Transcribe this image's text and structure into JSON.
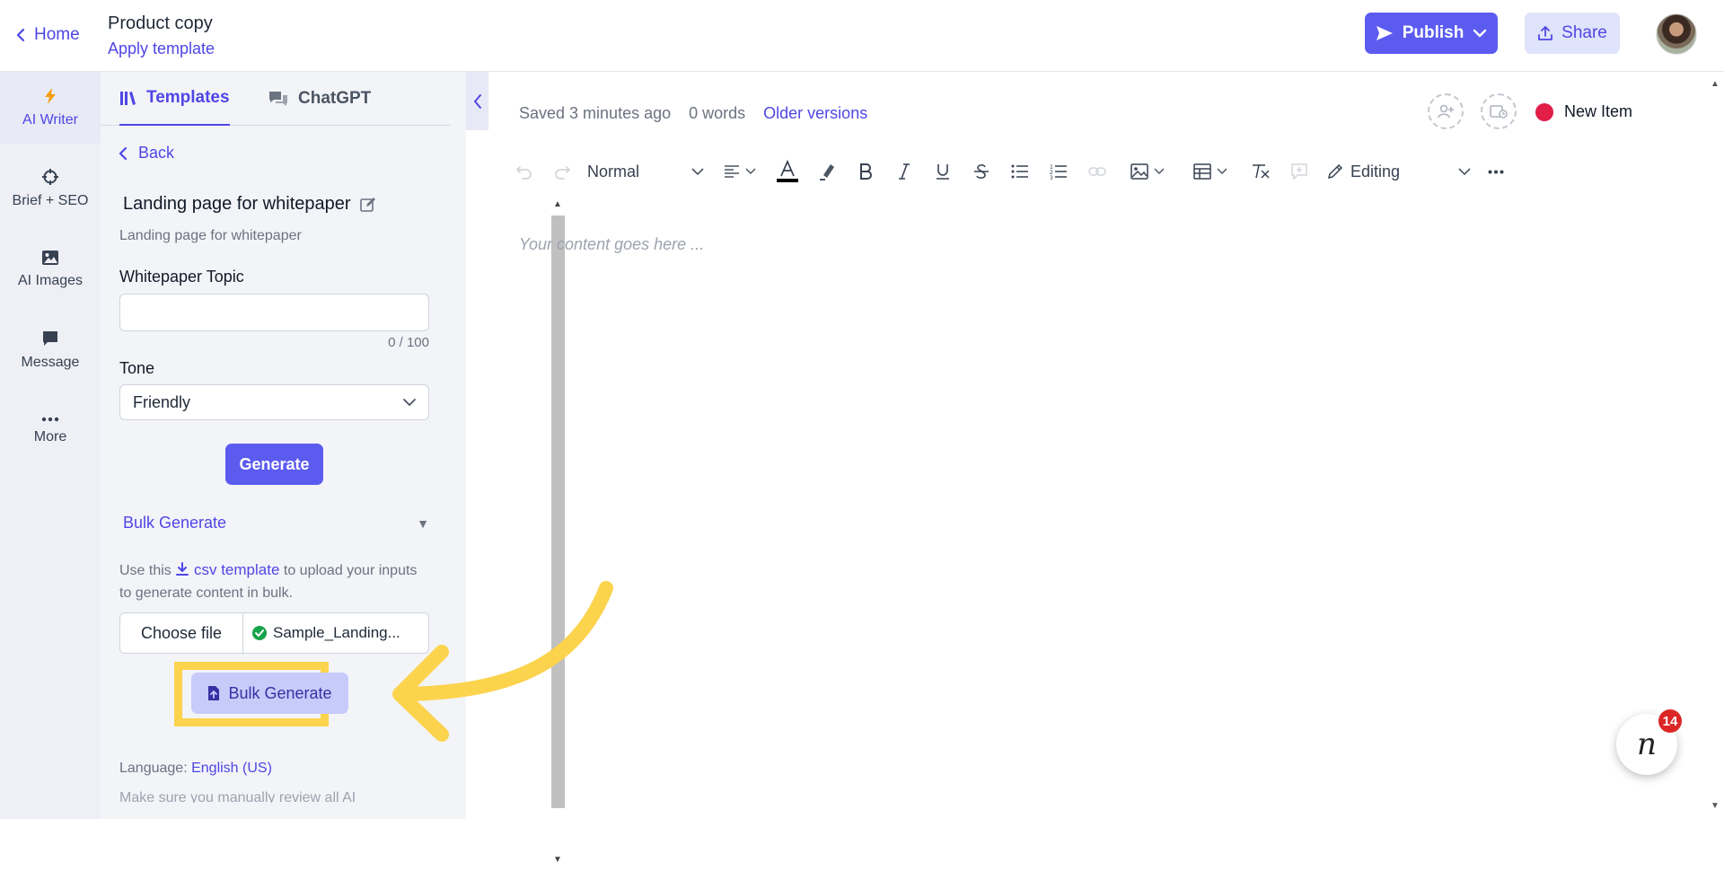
{
  "header": {
    "home_label": "Home",
    "doc_title": "Product copy",
    "apply_template_label": "Apply template",
    "publish_label": "Publish",
    "share_label": "Share"
  },
  "rail": {
    "items": [
      {
        "label": "AI Writer",
        "icon": "lightning-icon"
      },
      {
        "label": "Brief + SEO",
        "icon": "crosshair-icon"
      },
      {
        "label": "AI Images",
        "icon": "image-icon"
      },
      {
        "label": "Message",
        "icon": "message-icon"
      },
      {
        "label": "More",
        "icon": "more-dots-icon"
      }
    ]
  },
  "panel": {
    "tabs": [
      {
        "label": "Templates",
        "icon": "library-icon",
        "active": true
      },
      {
        "label": "ChatGPT",
        "icon": "chat-bubbles-icon",
        "active": false
      }
    ],
    "back_label": "Back",
    "template_title": "Landing page for whitepaper",
    "template_subtitle": "Landing page for whitepaper",
    "field_topic_label": "Whitepaper Topic",
    "field_topic_value": "",
    "field_topic_counter": "0 / 100",
    "tone_label": "Tone",
    "tone_value": "Friendly",
    "generate_label": "Generate",
    "bulk_header": "Bulk Generate",
    "bulk_help_prefix": "Use this",
    "bulk_help_link": "csv template",
    "bulk_help_suffix": "to upload your inputs to generate content in bulk.",
    "choose_file_label": "Choose file",
    "file_name": "Sample_Landing...",
    "bulk_button_label": "Bulk Generate",
    "language_label": "Language:",
    "language_value": "English (US)",
    "review_note": "Make sure you manually review all AI"
  },
  "editor": {
    "saved_text": "Saved 3 minutes ago",
    "words_text": "0 words",
    "older_versions_label": "Older versions",
    "status_label": "New Item",
    "status_color": "#e11d48",
    "paragraph_style": "Normal",
    "mode_label": "Editing",
    "placeholder": "Your content goes here ..."
  },
  "chat_widget": {
    "logo_letter": "n",
    "badge_count": "14"
  },
  "colors": {
    "accent": "#5b5bf0",
    "link": "#4f46e5",
    "highlight": "#fcd34d"
  }
}
